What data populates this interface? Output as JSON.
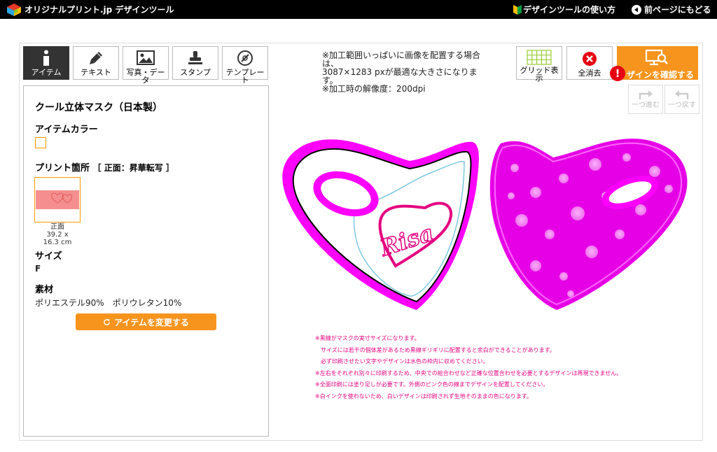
{
  "header": {
    "logo_text": "オリジナルプリント.jp デザインツール",
    "howto_link": "デザインツールの使い方",
    "back_link": "前ページにもどる"
  },
  "tabs": [
    {
      "label": "アイテム",
      "icon": "info-icon",
      "active": true
    },
    {
      "label": "テキスト",
      "icon": "pen-icon"
    },
    {
      "label": "写真・データ",
      "icon": "image-icon"
    },
    {
      "label": "スタンプ",
      "icon": "stamp-icon"
    },
    {
      "label": "テンプレート",
      "icon": "template-icon"
    }
  ],
  "item_panel": {
    "product_name": "クール立体マスク（日本製）",
    "color_heading": "アイテムカラー",
    "print_heading": "プリント箇所",
    "print_spec": "［ 正面：昇華転写 ］",
    "print_area_name": "正面",
    "print_area_size": "39.2 x 16.3 cm",
    "size_heading": "サイズ",
    "size_value": "F",
    "material_heading": "素材",
    "material_value": "ポリエステル90%　ポリウレタン10%",
    "change_button": "アイテムを変更する"
  },
  "info": {
    "line1": "※加工範囲いっぱいに画像を配置する場合は、",
    "line2": "3087×1283 pxが最適な大きさになります。",
    "line3": "※加工時の解像度：200dpi"
  },
  "toolbar": {
    "grid_label": "グリッド表示",
    "clear_label": "全消去",
    "confirm_label": "ザインを確認する",
    "alert_mark": "!",
    "redo_label": "一つ進む",
    "undo_label": "一つ戻す"
  },
  "canvas": {
    "design_text": "Risa"
  },
  "notes": [
    "※黒線がマスクの実寸サイズになります。",
    "　サイズには若干の個体差があるため黒線ギリギリに配置すると余白ができることがあります。",
    "　必ず印刷させたい文字やデザインは水色の枠内に収めてください。",
    "※左右をそれぞれ別々に印刷するため、中央での絵合わせなど正確な位置合わせを必要とするデザインは再現できません。",
    "※全面印刷には塗り足しが必要です。外側のピンク色の線までデザインを配置してください。",
    "※白インクを使わないため、白いデザインは印刷されず生地そのままの色になります。"
  ],
  "colors": {
    "accent_orange": "#f7941d",
    "magenta": "#e600e6",
    "guide_blue": "#9fd3e8",
    "note_pink": "#e6007e"
  }
}
